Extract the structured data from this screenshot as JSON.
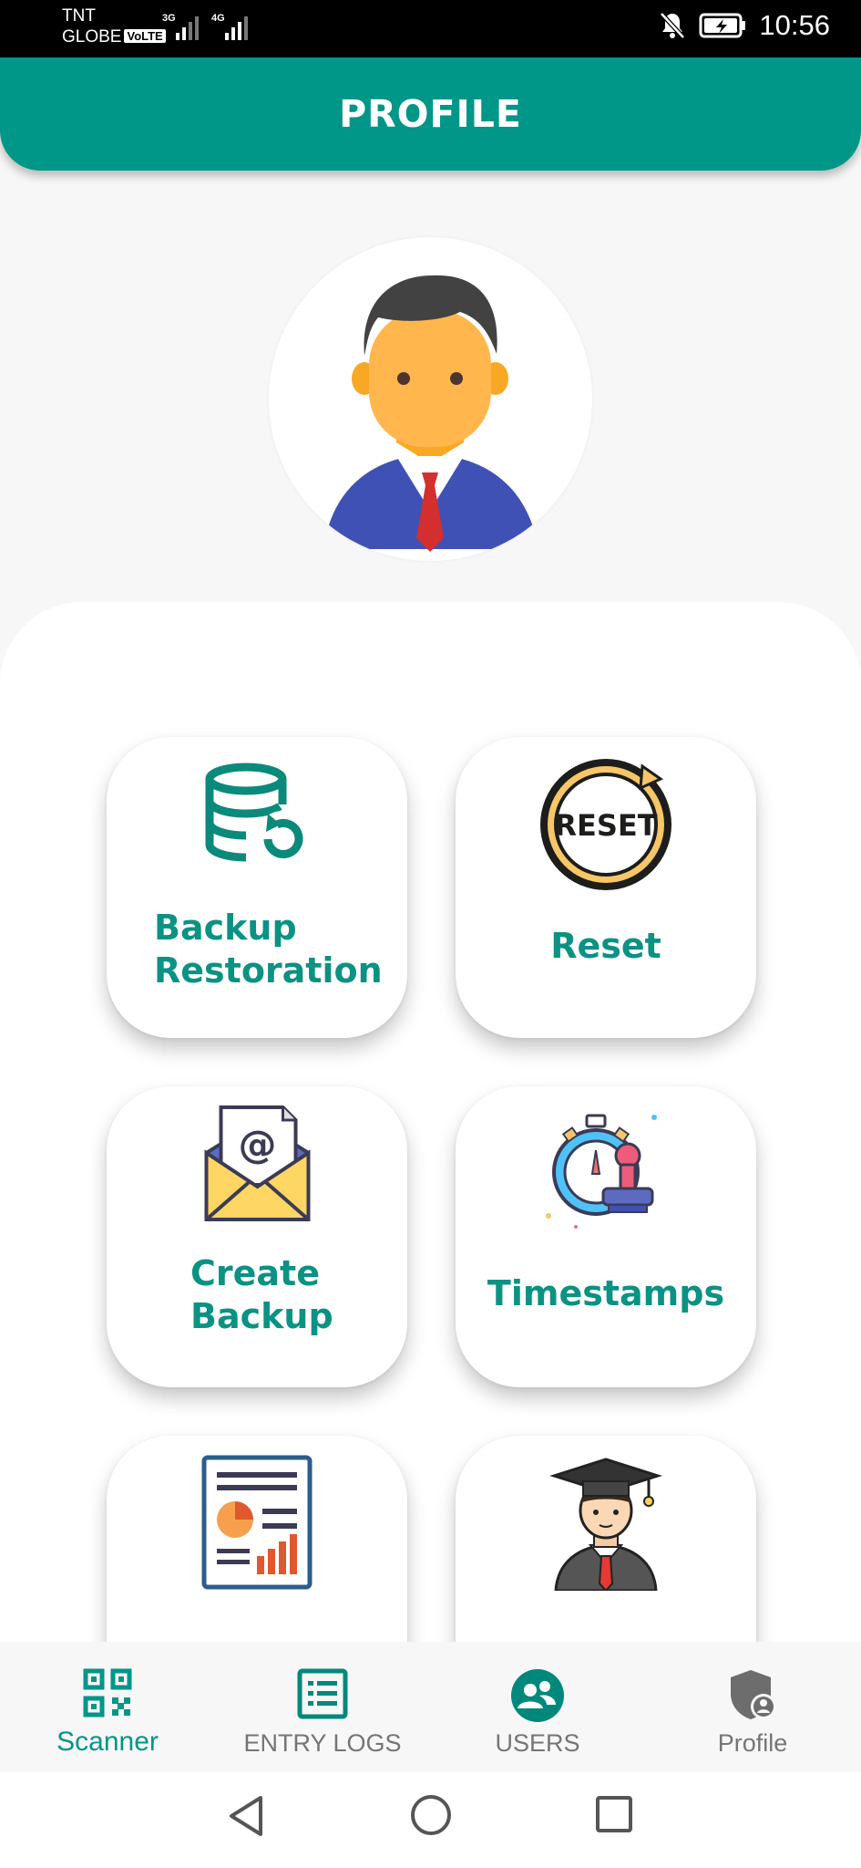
{
  "status_bar": {
    "carrier_1": "TNT",
    "carrier_2": "GLOBE",
    "volte": "VoLTE",
    "network_1": "3G",
    "network_2": "4G",
    "time": "10:56",
    "icons": [
      "signal-icon",
      "mute-notifications-icon",
      "battery-charging-icon"
    ]
  },
  "header": {
    "title": "PROFILE"
  },
  "avatar": {
    "icon": "user-avatar-icon"
  },
  "cards": [
    {
      "label": "Backup\nRestoration",
      "line1": "Backup",
      "line2": "Restoration",
      "icon": "database-restore-icon"
    },
    {
      "label": "Reset",
      "icon": "reset-icon"
    },
    {
      "line1": "Create",
      "line2": "Backup",
      "icon": "email-envelope-icon"
    },
    {
      "label": "Timestamps",
      "icon": "stopwatch-stamp-icon"
    },
    {
      "label": "",
      "icon": "report-document-icon"
    },
    {
      "label": "",
      "icon": "graduate-user-icon"
    }
  ],
  "bottom_nav": {
    "items": [
      {
        "label": "Scanner",
        "icon": "qr-code-icon",
        "active": true
      },
      {
        "label": "ENTRY LOGS",
        "icon": "list-icon",
        "active": false
      },
      {
        "label": "USERS",
        "icon": "users-icon",
        "active": false
      },
      {
        "label": "Profile",
        "icon": "shield-user-icon",
        "active": false
      }
    ]
  },
  "colors": {
    "primary": "#009688",
    "label_teal": "#0b9283",
    "inactive": "#757575"
  }
}
